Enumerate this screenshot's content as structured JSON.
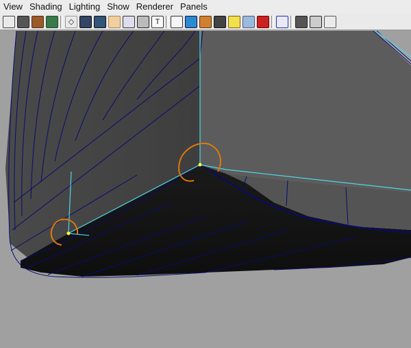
{
  "menu": [
    "View",
    "Shading",
    "Lighting",
    "Show",
    "Renderer",
    "Panels"
  ],
  "toolbar_icons": [
    {
      "name": "select-camera-icon",
      "glyph": "",
      "bg": "#eaeaea",
      "border": "#444"
    },
    {
      "name": "camera-attributes-icon",
      "glyph": "",
      "bg": "#555",
      "border": "#222"
    },
    {
      "name": "bookmarks-icon",
      "glyph": "",
      "bg": "#9a5a2a",
      "border": "#5a2a10"
    },
    {
      "name": "image-plane-icon",
      "glyph": "",
      "bg": "#3a7a4a",
      "border": "#1a4a2a"
    },
    {
      "sep": true
    },
    {
      "name": "grid-icon",
      "glyph": "◇",
      "bg": "#eaeaea",
      "border": "#999"
    },
    {
      "name": "film-gate-icon",
      "glyph": "",
      "bg": "#334466",
      "border": "#111"
    },
    {
      "name": "resolution-gate-icon",
      "glyph": "",
      "bg": "#335577",
      "border": "#111"
    },
    {
      "name": "gate-mask-icon",
      "glyph": "",
      "bg": "#f0d0a0",
      "border": "#b08050"
    },
    {
      "name": "field-chart-icon",
      "glyph": "",
      "bg": "#dde",
      "border": "#333"
    },
    {
      "name": "safe-action-icon",
      "glyph": "",
      "bg": "#bbb",
      "border": "#222"
    },
    {
      "name": "safe-title-icon",
      "glyph": "T",
      "bg": "#fafafa",
      "border": "#333"
    },
    {
      "sep": true
    },
    {
      "name": "wireframe-icon",
      "glyph": "",
      "bg": "#f5f5f5",
      "border": "#333"
    },
    {
      "name": "smooth-shade-icon",
      "glyph": "",
      "bg": "#2a8ad0",
      "border": "#114"
    },
    {
      "name": "textured-icon",
      "glyph": "",
      "bg": "#d08030",
      "border": "#603010"
    },
    {
      "name": "shadows-icon",
      "glyph": "",
      "bg": "#444",
      "border": "#111"
    },
    {
      "name": "lights-icon",
      "glyph": "",
      "bg": "#f0e050",
      "border": "#806000"
    },
    {
      "name": "xray-icon",
      "glyph": "",
      "bg": "#99bbdd",
      "border": "#557"
    },
    {
      "name": "default-material-icon",
      "glyph": "",
      "bg": "#cc2222",
      "border": "#600"
    },
    {
      "sep": true
    },
    {
      "name": "isolate-select-icon",
      "glyph": "",
      "bg": "#e8e8f8",
      "border": "#2233aa"
    },
    {
      "sep": true
    },
    {
      "name": "wireframe-on-shaded-icon",
      "glyph": "",
      "bg": "#555",
      "border": "#222"
    },
    {
      "name": "xray-joints-icon",
      "glyph": "",
      "bg": "#ccc",
      "border": "#222"
    },
    {
      "name": "camera-manipulator-icon",
      "glyph": "",
      "bg": "#eaeaea",
      "border": "#555"
    }
  ],
  "viewport": {
    "background": "#a0a0a0",
    "wire": "#0a0a70",
    "highlight": "#4fd6e8",
    "selection": "#e0780a",
    "vertex": "#ffff40"
  }
}
